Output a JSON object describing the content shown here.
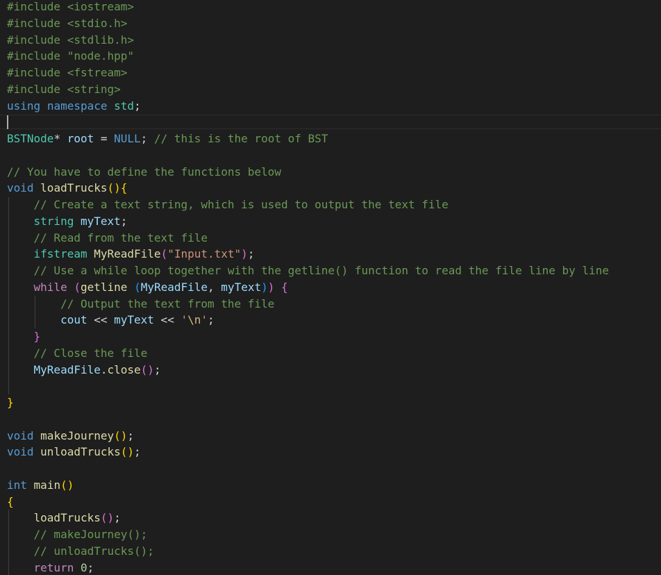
{
  "editor": {
    "colors": {
      "background": "#1e1e1e",
      "keyword": "#569cd6",
      "control": "#c586c0",
      "type": "#4ec9b0",
      "function": "#dcdcaa",
      "variable": "#9cdcfe",
      "string": "#ce9178",
      "number": "#b5cea8",
      "comment": "#6a9955",
      "escape": "#d7ba7d",
      "bracket1": "#ffd700",
      "bracket2": "#da70d6",
      "bracket3": "#179fff"
    },
    "lines": [
      [
        [
          "com",
          "#include <iostream>"
        ]
      ],
      [
        [
          "com",
          "#include <stdio.h>"
        ]
      ],
      [
        [
          "com",
          "#include <stdlib.h>"
        ]
      ],
      [
        [
          "com",
          "#include \"node.hpp\""
        ]
      ],
      [
        [
          "com",
          "#include <fstream>"
        ]
      ],
      [
        [
          "com",
          "#include <string>"
        ]
      ],
      [
        [
          "kw",
          "using"
        ],
        [
          "plain",
          " "
        ],
        [
          "kw",
          "namespace"
        ],
        [
          "plain",
          " "
        ],
        [
          "type",
          "std"
        ],
        [
          "plain",
          ";"
        ]
      ],
      [],
      [
        [
          "type",
          "BSTNode"
        ],
        [
          "plain",
          "* "
        ],
        [
          "var",
          "root"
        ],
        [
          "plain",
          " = "
        ],
        [
          "kw",
          "NULL"
        ],
        [
          "plain",
          "; "
        ],
        [
          "com",
          "// this is the root of BST"
        ]
      ],
      [],
      [
        [
          "com",
          "// You have to define the functions below"
        ]
      ],
      [
        [
          "kw",
          "void"
        ],
        [
          "plain",
          " "
        ],
        [
          "fn",
          "loadTrucks"
        ],
        [
          "p1",
          "(){"
        ]
      ],
      [
        [
          "plain",
          "    "
        ],
        [
          "com",
          "// Create a text string, which is used to output the text file"
        ]
      ],
      [
        [
          "plain",
          "    "
        ],
        [
          "type",
          "string"
        ],
        [
          "plain",
          " "
        ],
        [
          "var",
          "myText"
        ],
        [
          "plain",
          ";"
        ]
      ],
      [
        [
          "plain",
          "    "
        ],
        [
          "com",
          "// Read from the text file"
        ]
      ],
      [
        [
          "plain",
          "    "
        ],
        [
          "type",
          "ifstream"
        ],
        [
          "plain",
          " "
        ],
        [
          "fn",
          "MyReadFile"
        ],
        [
          "p2",
          "("
        ],
        [
          "str",
          "\"Input.txt\""
        ],
        [
          "p2",
          ")"
        ],
        [
          "plain",
          ";"
        ]
      ],
      [
        [
          "plain",
          "    "
        ],
        [
          "com",
          "// Use a while loop together with the getline() function to read the file line by line"
        ]
      ],
      [
        [
          "plain",
          "    "
        ],
        [
          "ctrl",
          "while"
        ],
        [
          "plain",
          " "
        ],
        [
          "p2",
          "("
        ],
        [
          "fn",
          "getline"
        ],
        [
          "plain",
          " "
        ],
        [
          "p3",
          "("
        ],
        [
          "var",
          "MyReadFile"
        ],
        [
          "plain",
          ", "
        ],
        [
          "var",
          "myText"
        ],
        [
          "p3",
          ")"
        ],
        [
          "p2",
          ")"
        ],
        [
          "plain",
          " "
        ],
        [
          "p2",
          "{"
        ]
      ],
      [
        [
          "plain",
          "        "
        ],
        [
          "com",
          "// Output the text from the file"
        ]
      ],
      [
        [
          "plain",
          "        "
        ],
        [
          "var",
          "cout"
        ],
        [
          "plain",
          " << "
        ],
        [
          "var",
          "myText"
        ],
        [
          "plain",
          " << "
        ],
        [
          "str",
          "'"
        ],
        [
          "esc",
          "\\n"
        ],
        [
          "str",
          "'"
        ],
        [
          "plain",
          ";"
        ]
      ],
      [
        [
          "plain",
          "    "
        ],
        [
          "p2",
          "}"
        ]
      ],
      [
        [
          "plain",
          "    "
        ],
        [
          "com",
          "// Close the file"
        ]
      ],
      [
        [
          "plain",
          "    "
        ],
        [
          "var",
          "MyReadFile"
        ],
        [
          "plain",
          "."
        ],
        [
          "fn",
          "close"
        ],
        [
          "p2",
          "()"
        ],
        [
          "plain",
          ";"
        ]
      ],
      [],
      [
        [
          "p1",
          "}"
        ]
      ],
      [],
      [
        [
          "kw",
          "void"
        ],
        [
          "plain",
          " "
        ],
        [
          "fn",
          "makeJourney"
        ],
        [
          "p1",
          "()"
        ],
        [
          "plain",
          ";"
        ]
      ],
      [
        [
          "kw",
          "void"
        ],
        [
          "plain",
          " "
        ],
        [
          "fn",
          "unloadTrucks"
        ],
        [
          "p1",
          "()"
        ],
        [
          "plain",
          ";"
        ]
      ],
      [],
      [
        [
          "kw",
          "int"
        ],
        [
          "plain",
          " "
        ],
        [
          "fn",
          "main"
        ],
        [
          "p1",
          "()"
        ]
      ],
      [
        [
          "p1",
          "{"
        ]
      ],
      [
        [
          "plain",
          "    "
        ],
        [
          "fn",
          "loadTrucks"
        ],
        [
          "p2",
          "()"
        ],
        [
          "plain",
          ";"
        ]
      ],
      [
        [
          "plain",
          "    "
        ],
        [
          "com",
          "// makeJourney();"
        ]
      ],
      [
        [
          "plain",
          "    "
        ],
        [
          "com",
          "// unloadTrucks();"
        ]
      ],
      [
        [
          "plain",
          "    "
        ],
        [
          "ctrl",
          "return"
        ],
        [
          "plain",
          " "
        ],
        [
          "num",
          "0"
        ],
        [
          "plain",
          ";"
        ]
      ]
    ]
  }
}
